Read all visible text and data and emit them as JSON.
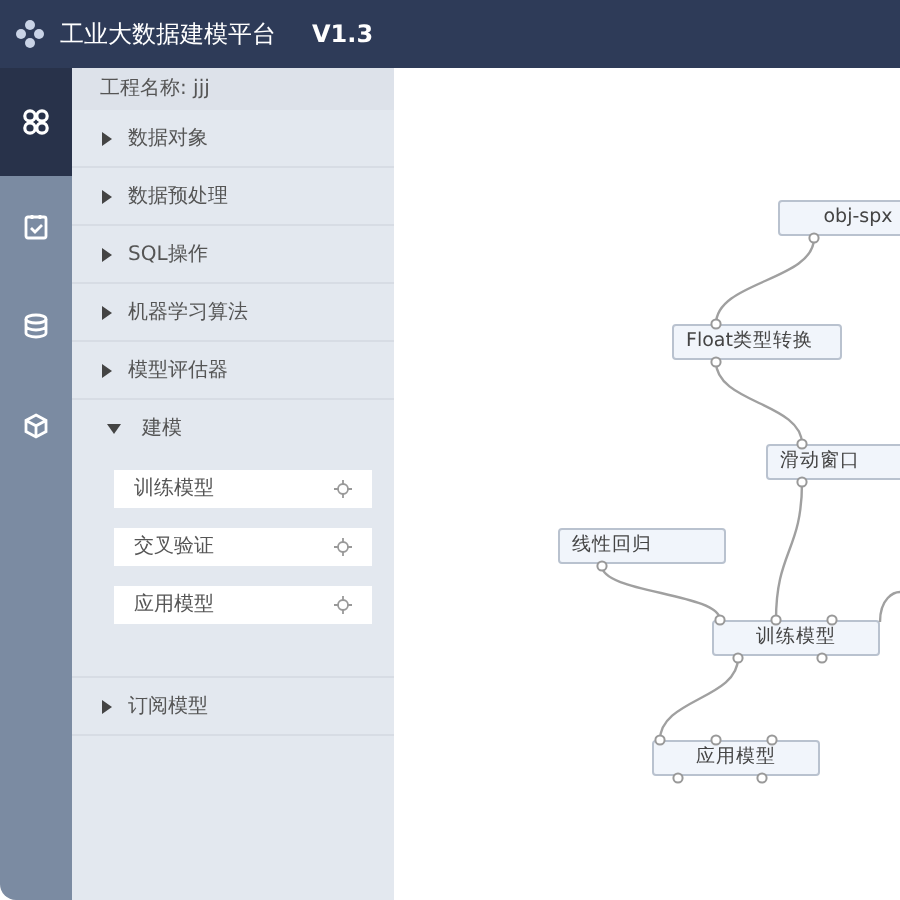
{
  "header": {
    "title": "工业大数据建模平台",
    "version": "V1.3"
  },
  "rail": [
    {
      "kind": "modules",
      "selected": true
    },
    {
      "kind": "tasks",
      "selected": false
    },
    {
      "kind": "database",
      "selected": false
    },
    {
      "kind": "cube",
      "selected": false
    }
  ],
  "project": {
    "label": "工程名称:",
    "value": "jjj"
  },
  "categories": [
    {
      "label": "数据对象",
      "expanded": false
    },
    {
      "label": "数据预处理",
      "expanded": false
    },
    {
      "label": "SQL操作",
      "expanded": false
    },
    {
      "label": "机器学习算法",
      "expanded": false
    },
    {
      "label": "模型评估器",
      "expanded": false
    },
    {
      "label": "建模",
      "expanded": true,
      "children": [
        {
          "label": "训练模型"
        },
        {
          "label": "交叉验证"
        },
        {
          "label": "应用模型"
        }
      ]
    },
    {
      "label": "订阅模型",
      "expanded": false
    }
  ],
  "canvas": {
    "nodes": [
      {
        "label": "obj-spx"
      },
      {
        "label": "Float类型转换"
      },
      {
        "label": "滑动窗口"
      },
      {
        "label": "线性回归"
      },
      {
        "label": "训练模型"
      },
      {
        "label": "应用模型"
      }
    ]
  }
}
